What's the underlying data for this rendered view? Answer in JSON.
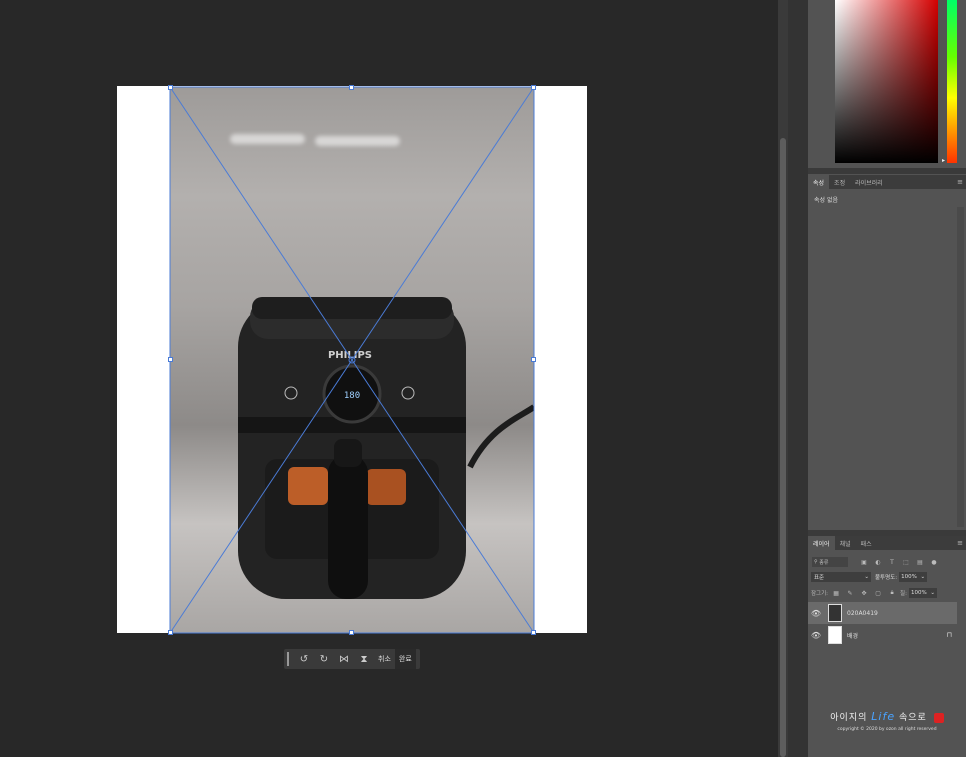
{
  "panels": {
    "properties_tabs": [
      {
        "label": "속성",
        "active": true
      },
      {
        "label": "조정",
        "active": false
      },
      {
        "label": "라이브러리",
        "active": false
      }
    ],
    "properties_empty": "속성 없음",
    "layers_tabs": [
      {
        "label": "레이어",
        "active": true
      },
      {
        "label": "채널",
        "active": false
      },
      {
        "label": "패스",
        "active": false
      }
    ],
    "filter_kind": "종류",
    "blend_mode": "표준",
    "opacity_label": "불투명도:",
    "opacity_value": "100%",
    "lock_label": "잠그기:",
    "fill_label": "칠:",
    "fill_value": "100%",
    "layers": [
      {
        "name": "020A0419",
        "selected": true,
        "visible": true
      },
      {
        "name": "배경",
        "selected": false,
        "visible": true,
        "locked": true
      }
    ]
  },
  "transform_toolbar": {
    "cancel_label": "취소",
    "done_label": "완료"
  },
  "watermark": {
    "title_pre": "아이지의",
    "title_life": "Life",
    "title_post": "속으로",
    "copyright": "copyright © 2020 by ozon all right reserved"
  },
  "colors": {
    "picker_hue": "#d40000",
    "selection_stroke": "#4a7bd6"
  }
}
